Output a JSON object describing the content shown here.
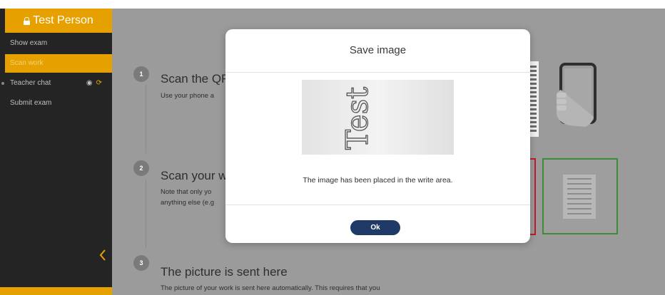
{
  "sidebar": {
    "user_name": "Test Person",
    "items": [
      {
        "label": "Show exam",
        "active": false
      },
      {
        "label": "Scan work",
        "active": true
      },
      {
        "label": "Teacher chat",
        "active": false
      },
      {
        "label": "Submit exam",
        "active": false
      }
    ],
    "accent_color": "#e6a100"
  },
  "steps": [
    {
      "number": "1",
      "title": "Scan the QR",
      "text": "Use your phone a"
    },
    {
      "number": "2",
      "title": "Scan your w",
      "text_lines": [
        "Note that only yo",
        "anything else (e.g"
      ]
    },
    {
      "number": "3",
      "title": "The picture is sent here",
      "text": "The picture of your work is sent here automatically. This requires that you"
    }
  ],
  "modal": {
    "title": "Save image",
    "image_text": "Test",
    "message": "The image has been placed in the write area.",
    "ok_label": "Ok"
  }
}
